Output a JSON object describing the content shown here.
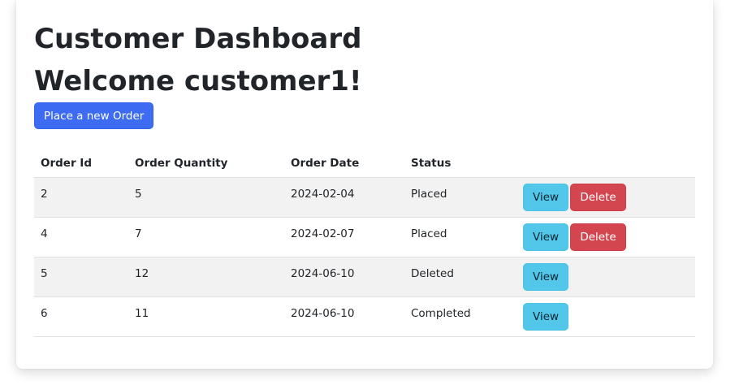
{
  "header": {
    "title": "Customer Dashboard",
    "welcome": "Welcome customer1!"
  },
  "actions": {
    "new_order_label": "Place a new Order"
  },
  "table": {
    "columns": [
      "Order Id",
      "Order Quantity",
      "Order Date",
      "Status",
      ""
    ],
    "view_label": "View",
    "delete_label": "Delete",
    "rows": [
      {
        "id": "2",
        "quantity": "5",
        "date": "2024-02-04",
        "status": "Placed",
        "can_delete": true
      },
      {
        "id": "4",
        "quantity": "7",
        "date": "2024-02-07",
        "status": "Placed",
        "can_delete": true
      },
      {
        "id": "5",
        "quantity": "12",
        "date": "2024-06-10",
        "status": "Deleted",
        "can_delete": false
      },
      {
        "id": "6",
        "quantity": "11",
        "date": "2024-06-10",
        "status": "Completed",
        "can_delete": false
      }
    ]
  },
  "colors": {
    "primary": "#3d6cf2",
    "info": "#53c7ea",
    "danger": "#d34650",
    "stripe": "#f2f2f2"
  }
}
